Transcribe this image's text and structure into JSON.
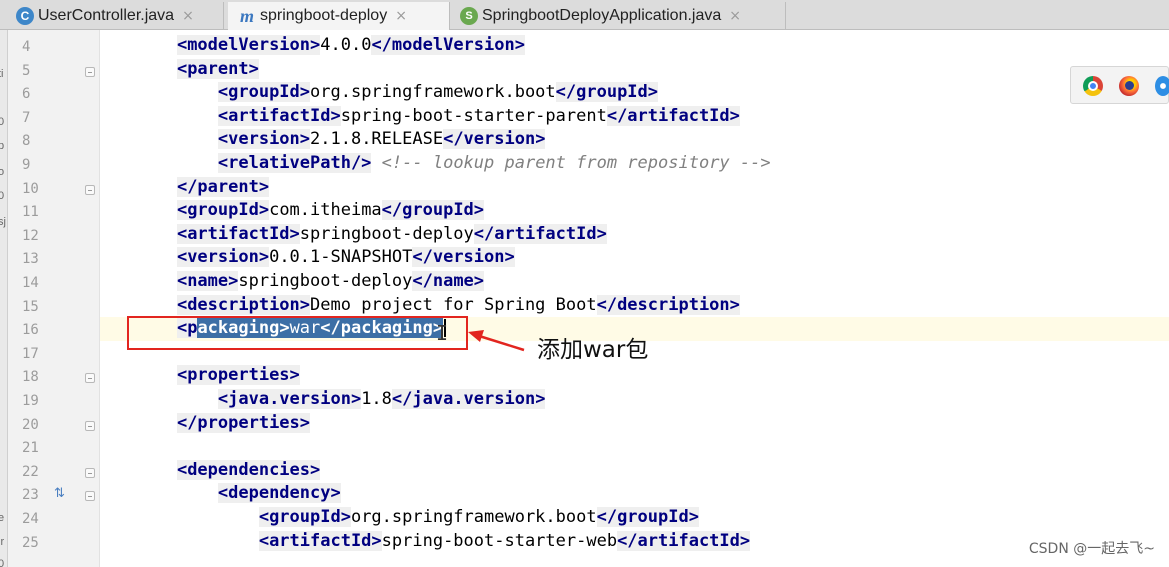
{
  "tabs": [
    {
      "label": "UserController.java",
      "icon": "class-c-icon",
      "close": "×"
    },
    {
      "label": "springboot-deploy",
      "icon": "maven-m-icon",
      "close": "×"
    },
    {
      "label": "SpringbootDeployApplication.java",
      "icon": "spring-boot-class-icon",
      "close": "×"
    }
  ],
  "left_strip_chars": [
    "ti",
    "0",
    "p",
    "o",
    "0",
    "sj",
    "i",
    "e",
    "ir",
    "0"
  ],
  "editor": {
    "line_numbers": [
      "4",
      "5",
      "6",
      "7",
      "8",
      "9",
      "10",
      "11",
      "12",
      "13",
      "14",
      "15",
      "16",
      "17",
      "18",
      "19",
      "20",
      "21",
      "22",
      "23",
      "24",
      "25"
    ],
    "lines": [
      {
        "indent": "    ",
        "open": "<modelVersion>",
        "text": "4.0.0",
        "close": "</modelVersion>"
      },
      {
        "indent": "    ",
        "open": "<parent>",
        "text": "",
        "close": ""
      },
      {
        "indent": "        ",
        "open": "<groupId>",
        "text": "org.springframework.boot",
        "close": "</groupId>"
      },
      {
        "indent": "        ",
        "open": "<artifactId>",
        "text": "spring-boot-starter-parent",
        "close": "</artifactId>"
      },
      {
        "indent": "        ",
        "open": "<version>",
        "text": "2.1.8.RELEASE",
        "close": "</version>"
      },
      {
        "indent": "        ",
        "open": "<relativePath/>",
        "text": " ",
        "close": "",
        "comment": "<!-- lookup parent from repository -->"
      },
      {
        "indent": "    ",
        "open": "</parent>",
        "text": "",
        "close": ""
      },
      {
        "indent": "    ",
        "open": "<groupId>",
        "text": "com.itheima",
        "close": "</groupId>"
      },
      {
        "indent": "    ",
        "open": "<artifactId>",
        "text": "springboot-deploy",
        "close": "</artifactId>"
      },
      {
        "indent": "    ",
        "open": "<version>",
        "text": "0.0.1-SNAPSHOT",
        "close": "</version>"
      },
      {
        "indent": "    ",
        "open": "<name>",
        "text": "springboot-deploy",
        "close": "</name>"
      },
      {
        "indent": "    ",
        "open": "<description>",
        "text": "Demo project for Spring Boot",
        "close": "</description>"
      },
      {
        "indent": "    ",
        "current": true,
        "pre": "<p",
        "sel_open": "ackaging>",
        "sel_text": "war",
        "sel_close": "</packaging>"
      },
      {
        "indent": "",
        "open": "",
        "text": "",
        "close": ""
      },
      {
        "indent": "    ",
        "open": "<properties>",
        "text": "",
        "close": ""
      },
      {
        "indent": "        ",
        "open": "<java.version>",
        "text": "1.8",
        "close": "</java.version>"
      },
      {
        "indent": "    ",
        "open": "</properties>",
        "text": "",
        "close": ""
      },
      {
        "indent": "",
        "open": "",
        "text": "",
        "close": ""
      },
      {
        "indent": "    ",
        "open": "<dependencies>",
        "text": "",
        "close": ""
      },
      {
        "indent": "        ",
        "open": "<dependency>",
        "text": "",
        "close": ""
      },
      {
        "indent": "            ",
        "open": "<groupId>",
        "text": "org.springframework.boot",
        "close": "</groupId>"
      },
      {
        "indent": "            ",
        "open": "<artifactId>",
        "text": "spring-boot-starter-web",
        "close": "</artifactId>"
      }
    ]
  },
  "fold_lines": [
    "5",
    "10",
    "18",
    "20",
    "22",
    "23"
  ],
  "annotation": {
    "text": "添加war包",
    "color": "#e2251f"
  },
  "browser_icons": [
    "chrome-icon",
    "firefox-icon",
    "safari-icon"
  ],
  "watermark": "CSDN @一起去飞~"
}
